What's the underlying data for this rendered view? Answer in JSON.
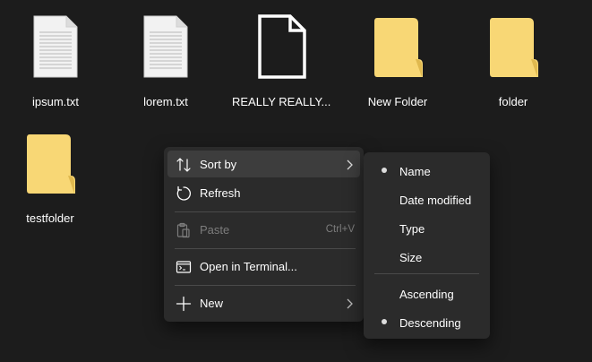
{
  "desktop": {
    "files": [
      {
        "name": "ipsum.txt",
        "type": "text-file"
      },
      {
        "name": "lorem.txt",
        "type": "text-file"
      },
      {
        "name": "REALLY REALLY...",
        "type": "blank-file"
      },
      {
        "name": "New Folder",
        "type": "folder"
      },
      {
        "name": "folder",
        "type": "folder"
      },
      {
        "name": "testfolder",
        "type": "folder"
      }
    ]
  },
  "context_menu": {
    "sort_by": "Sort by",
    "refresh": "Refresh",
    "paste": "Paste",
    "paste_shortcut": "Ctrl+V",
    "open_terminal": "Open in Terminal...",
    "new": "New"
  },
  "sort_submenu": {
    "name": "Name",
    "date_modified": "Date modified",
    "type": "Type",
    "size": "Size",
    "ascending": "Ascending",
    "descending": "Descending",
    "selected_field": "Name",
    "selected_order": "Descending"
  },
  "colors": {
    "background": "#1c1c1c",
    "menu_bg": "#2b2b2b",
    "folder": "#f8d775",
    "disabled_text": "#7c7c7c"
  }
}
